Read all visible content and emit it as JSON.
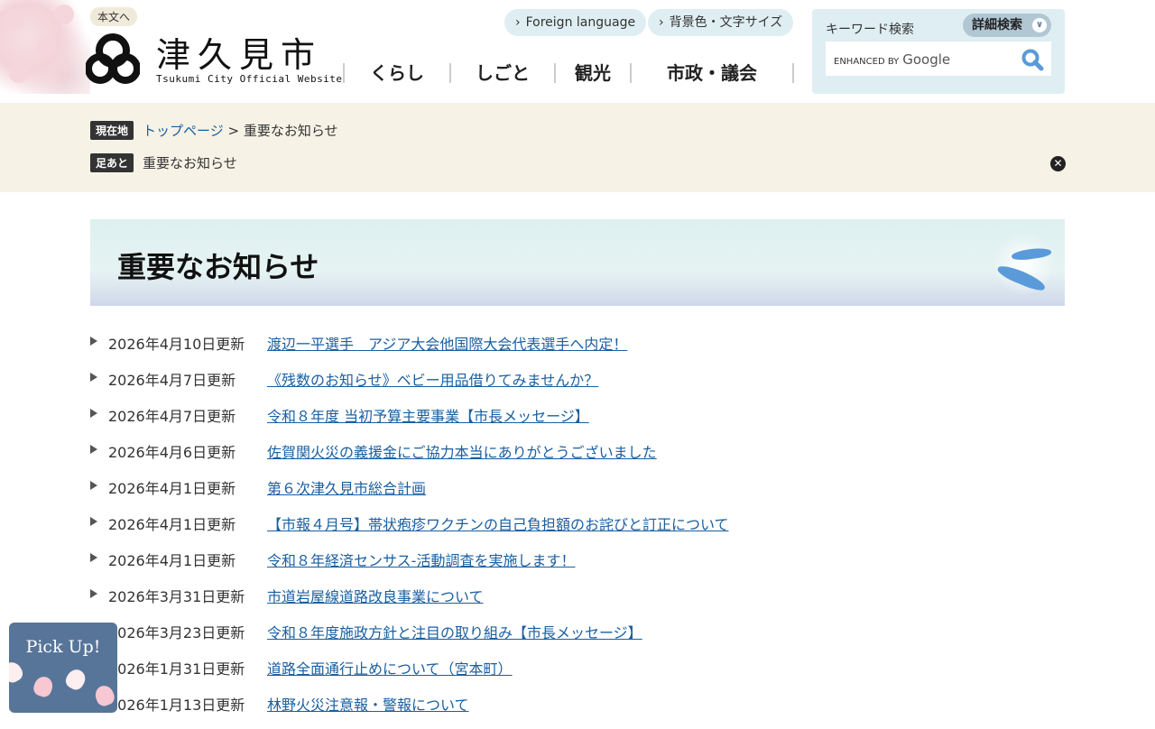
{
  "header": {
    "skip_link": "本文へ",
    "logo_jp": "津久見市",
    "logo_en": "Tsukumi City Official Website",
    "nav": [
      "くらし",
      "しごと",
      "観光",
      "市政・議会"
    ],
    "foreign_language": "Foreign language",
    "display_settings": "背景色・文字サイズ",
    "search": {
      "label": "キーワード検索",
      "advanced": "詳細検索",
      "enhanced_by": "ENHANCED BY",
      "google": "Google"
    }
  },
  "breadcrumb": {
    "current_tag": "現在地",
    "top_link": "トップページ",
    "separator": " > ",
    "current": "重要なお知らせ",
    "history_tag": "足あと",
    "history_item": "重要なお知らせ"
  },
  "page_title": "重要なお知らせ",
  "news": [
    {
      "date": "2026年4月10日更新",
      "title": "渡辺一平選手　アジア大会他国際大会代表選手へ内定！"
    },
    {
      "date": "2026年4月7日更新",
      "title": "《残数のお知らせ》ベビー用品借りてみませんか？"
    },
    {
      "date": "2026年4月7日更新",
      "title": "令和８年度 当初予算主要事業【市長メッセージ】"
    },
    {
      "date": "2026年4月6日更新",
      "title": "佐賀関火災の義援金にご協力本当にありがとうございました"
    },
    {
      "date": "2026年4月1日更新",
      "title": "第６次津久見市総合計画"
    },
    {
      "date": "2026年4月1日更新",
      "title": "【市報４月号】帯状疱疹ワクチンの自己負担額のお詫びと訂正について"
    },
    {
      "date": "2026年4月1日更新",
      "title": "令和８年経済センサス‐活動調査を実施します！"
    },
    {
      "date": "2026年3月31日更新",
      "title": "市道岩屋線道路改良事業について"
    },
    {
      "date": "2026年3月23日更新",
      "title": "令和８年度施政方針と注目の取り組み【市長メッセージ】"
    },
    {
      "date": "2026年1月31日更新",
      "title": "道路全面通行止めについて（宮本町）"
    },
    {
      "date": "2026年1月13日更新",
      "title": "林野火災注意報・警報について"
    }
  ],
  "pickup": "Pick Up!"
}
